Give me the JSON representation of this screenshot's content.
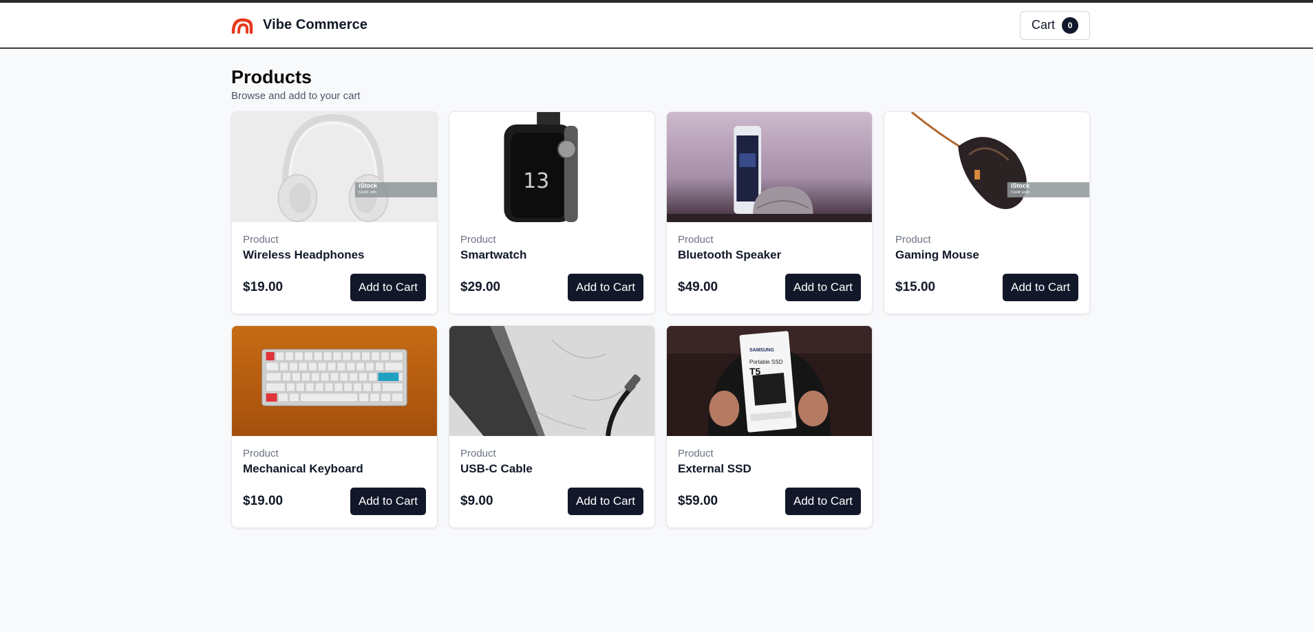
{
  "header": {
    "brand_name": "Vibe Commerce",
    "logo_color": "#e8391d",
    "cart_label": "Cart",
    "cart_count": "0"
  },
  "page": {
    "title": "Products",
    "subtitle": "Browse and add to your cart"
  },
  "products": [
    {
      "category": "Product",
      "name": "Wireless Headphones",
      "price": "$19.00",
      "button": "Add to Cart",
      "image": "headphones-photo",
      "watermark": "iStock",
      "watermark_credit": "Credit: urfin"
    },
    {
      "category": "Product",
      "name": "Smartwatch",
      "price": "$29.00",
      "button": "Add to Cart",
      "image": "smartwatch-photo"
    },
    {
      "category": "Product",
      "name": "Bluetooth Speaker",
      "price": "$49.00",
      "button": "Add to Cart",
      "image": "speaker-photo"
    },
    {
      "category": "Product",
      "name": "Gaming Mouse",
      "price": "$15.00",
      "button": "Add to Cart",
      "image": "mouse-photo",
      "watermark": "iStock",
      "watermark_credit": "Credit: jevtic"
    },
    {
      "category": "Product",
      "name": "Mechanical Keyboard",
      "price": "$19.00",
      "button": "Add to Cart",
      "image": "keyboard-photo"
    },
    {
      "category": "Product",
      "name": "USB-C Cable",
      "price": "$9.00",
      "button": "Add to Cart",
      "image": "cable-photo"
    },
    {
      "category": "Product",
      "name": "External SSD",
      "price": "$59.00",
      "button": "Add to Cart",
      "image": "ssd-photo",
      "package_brand": "SAMSUNG",
      "package_model": "T5",
      "package_text": "Portable SSD"
    }
  ],
  "colors": {
    "accent": "#121729",
    "logo": "#e8391d",
    "background": "#f8f9fb"
  }
}
